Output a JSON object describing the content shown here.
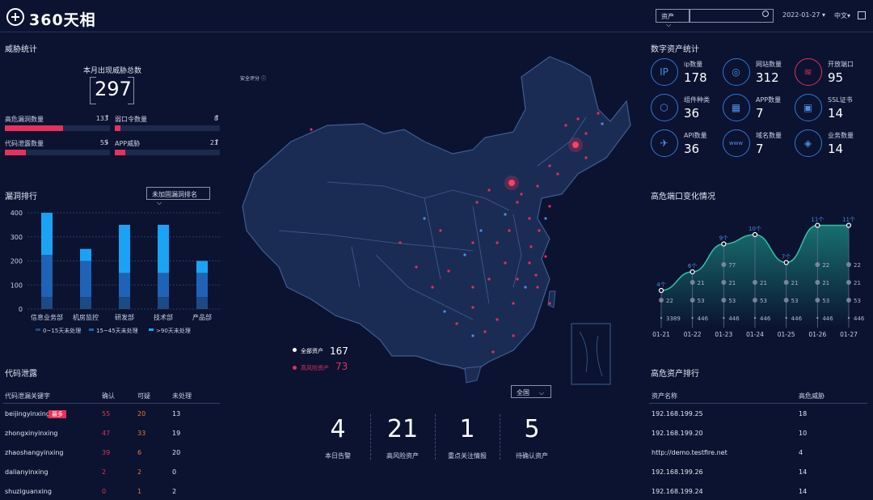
{
  "header": {
    "logo_text": "360天相",
    "asset_select": "资产",
    "date": "2022-01-27",
    "lang": "中文"
  },
  "threat": {
    "title": "威胁统计",
    "total_label": "本月出现威胁总数",
    "total": "297",
    "items": [
      {
        "label": "高危漏洞数量",
        "value": "133",
        "trend": "↑",
        "fraction": 0.55
      },
      {
        "label": "弱口令数量",
        "value": "8",
        "trend": "↑",
        "fraction": 0.05
      },
      {
        "label": "代码泄露数量",
        "value": "55",
        "trend": "↓",
        "fraction": 0.2
      },
      {
        "label": "APP威胁",
        "value": "21",
        "trend": "↑",
        "fraction": 0.1
      }
    ]
  },
  "vuln_rank": {
    "title": "漏洞排行",
    "dropdown": "未加固漏洞排名"
  },
  "code_leak": {
    "title": "代码泄露",
    "headers": [
      "代码泄漏关键字",
      "确认",
      "可疑",
      "未处理"
    ],
    "most_badge": "最多",
    "rows": [
      {
        "keyword": "beijingyinxing",
        "confirm": "55",
        "suspect": "20",
        "pending": "13"
      },
      {
        "keyword": "zhongxinyinxing",
        "confirm": "47",
        "suspect": "33",
        "pending": "19"
      },
      {
        "keyword": "zhaoshangyinxing",
        "confirm": "39",
        "suspect": "6",
        "pending": "20"
      },
      {
        "keyword": "dalianyinxing",
        "confirm": "2",
        "suspect": "2",
        "pending": "0"
      },
      {
        "keyword": "shuziguanxing",
        "confirm": "0",
        "suspect": "1",
        "pending": "2"
      }
    ]
  },
  "map": {
    "security_score": "安全评分",
    "legend_all_label": "全部资产",
    "legend_all_value": "167",
    "legend_risk_label": "高风险资产",
    "legend_risk_value": "73",
    "filter": "全国"
  },
  "stats": [
    {
      "value": "4",
      "label": "本日告警"
    },
    {
      "value": "21",
      "label": "高风险资产"
    },
    {
      "value": "1",
      "label": "重点关注情报"
    },
    {
      "value": "5",
      "label": "待确认资产"
    }
  ],
  "digital_assets": {
    "title": "数字资产统计",
    "items": [
      {
        "label": "ip数量",
        "value": "178",
        "icon": "IP"
      },
      {
        "label": "网站数量",
        "value": "312",
        "icon": "◎"
      },
      {
        "label": "开放端口",
        "value": "95",
        "icon": "≋",
        "alert": true
      },
      {
        "label": "组件种类",
        "value": "36",
        "icon": "⬡"
      },
      {
        "label": "APP数量",
        "value": "7",
        "icon": "▦"
      },
      {
        "label": "SSL证书",
        "value": "14",
        "icon": "▣"
      },
      {
        "label": "API数量",
        "value": "36",
        "icon": "✈"
      },
      {
        "label": "域名数量",
        "value": "7",
        "icon": "www"
      },
      {
        "label": "业务数量",
        "value": "14",
        "icon": "◈"
      }
    ]
  },
  "port_change": {
    "title": "高危端口变化情况"
  },
  "high_risk": {
    "title": "高危资产排行",
    "headers": [
      "资产名称",
      "高危威胁"
    ],
    "rows": [
      {
        "name": "192.168.199.25",
        "value": "18"
      },
      {
        "name": "192.168.199.20",
        "value": "10"
      },
      {
        "name": "http://demo.testfire.net",
        "value": "4"
      },
      {
        "name": "192.168.199.26",
        "value": "14"
      },
      {
        "name": "192.168.199.24",
        "value": "14"
      }
    ]
  },
  "chart_data": [
    {
      "type": "bar",
      "categories": [
        "信息业务部",
        "机房监控",
        "研发部",
        "技术部",
        "产品部"
      ],
      "series": [
        {
          "name": "0~15天未处理",
          "values": [
            50,
            50,
            50,
            50,
            50
          ],
          "color": "#1c4a86"
        },
        {
          "name": "15~45天未处理",
          "values": [
            175,
            150,
            100,
            100,
            100
          ],
          "color": "#1f63b6"
        },
        {
          "name": ">90天未处理",
          "values": [
            175,
            50,
            200,
            200,
            50
          ],
          "color": "#1aa3f5"
        }
      ],
      "yticks": [
        0,
        100,
        200,
        300,
        400
      ],
      "ylim": [
        0,
        400
      ]
    },
    {
      "type": "line",
      "categories": [
        "01-21",
        "01-22",
        "01-23",
        "01-24",
        "01-25",
        "01-26",
        "01-27"
      ],
      "top_labels": [
        "4个",
        "6个",
        "9个",
        "10个",
        "7个",
        "11个",
        "11个"
      ],
      "values": [
        4,
        6,
        9,
        10,
        7,
        11,
        11
      ],
      "ylim": [
        0,
        12
      ],
      "point_labels": [
        [
          "22",
          "3389"
        ],
        [
          "21",
          "53",
          "446"
        ],
        [
          "77",
          "21",
          "53",
          "446"
        ],
        [
          "21",
          "53",
          "446"
        ],
        [
          "21",
          "53",
          "446"
        ],
        [
          "22",
          "21",
          "53",
          "446"
        ],
        [
          "22",
          "21",
          "53",
          "446"
        ]
      ]
    }
  ]
}
